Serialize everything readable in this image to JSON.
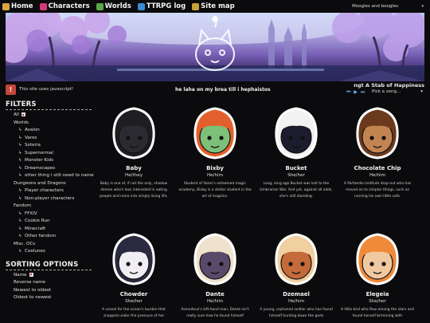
{
  "nav": {
    "items": [
      {
        "label": "Home",
        "icon": "home-icon",
        "color": "#d9a441"
      },
      {
        "label": "Characters",
        "icon": "characters-icon",
        "color": "#d23a7a"
      },
      {
        "label": "Worlds",
        "icon": "worlds-icon",
        "color": "#5aa84a"
      },
      {
        "label": "TTRPG log",
        "icon": "dice-icon",
        "color": "#3a8bd2"
      },
      {
        "label": "Site map",
        "icon": "map-icon",
        "color": "#c9a23a"
      }
    ],
    "theme_select": "Moogles and boogles"
  },
  "info": {
    "js_warning": "This site uses javascript!",
    "marquee": "he laha on my brea till i hephaistos"
  },
  "player": {
    "song_title": "ngt A Stab of Happiness",
    "pick_label": "Pick a song..."
  },
  "sidebar": {
    "filters_title": "FILTERS",
    "filters": [
      {
        "label": "All",
        "level": 0,
        "checkbox": true
      },
      {
        "label": "Worlds",
        "level": 0
      },
      {
        "label": "Avalon",
        "level": 1
      },
      {
        "label": "Varos",
        "level": 1
      },
      {
        "label": "Soteria",
        "level": 1
      },
      {
        "label": "Supernormal",
        "level": 1
      },
      {
        "label": "Monster Kids",
        "level": 1
      },
      {
        "label": "Dreamscapes",
        "level": 1
      },
      {
        "label": "other thing i still need to name",
        "level": 1
      },
      {
        "label": "Dungeons and Dragons",
        "level": 0
      },
      {
        "label": "Player characters",
        "level": 1
      },
      {
        "label": "Non-player characters",
        "level": 1
      },
      {
        "label": "Fandom",
        "level": 0
      },
      {
        "label": "FFXIV",
        "level": 1
      },
      {
        "label": "Cookie Run",
        "level": 1
      },
      {
        "label": "Minecraft",
        "level": 1
      },
      {
        "label": "Other fandom",
        "level": 1
      },
      {
        "label": "Misc. OCs",
        "level": 0
      },
      {
        "label": "Coelunes",
        "level": 1
      }
    ],
    "sorting_title": "SORTING OPTIONS",
    "sorting": [
      {
        "label": "Name",
        "checkbox": true
      },
      {
        "label": "Reverse name"
      },
      {
        "label": "Newest to oldest"
      },
      {
        "label": "Oldest to newest"
      }
    ]
  },
  "characters": [
    {
      "name": "Baby",
      "pronouns": "He/they",
      "desc": "Baby is one of, if not the only, shadow demon who's less interested in eating people and more into simply living life.",
      "hair": "#1e1e22",
      "skin": "#2a2a30"
    },
    {
      "name": "Bixby",
      "pronouns": "He/him",
      "desc": "Student of Varos's esteemed magic academy, Bixby is a stellar student in the art of magicks.",
      "hair": "#e3602c",
      "skin": "#7dc07a"
    },
    {
      "name": "Bucket",
      "pronouns": "She/her",
      "desc": "Long, long ago Bucket was lost to the Umbrarian War. And yet, against all odds, she's still standing.",
      "hair": "#f2f2f2",
      "skin": "#1c1c2c"
    },
    {
      "name": "Chocolate Chip",
      "pronouns": "He/him",
      "desc": "A Parfaedia institute drop-out who has moved on to simpler things, such as running his own little cafe.",
      "hair": "#6b3a1e",
      "skin": "#c28552"
    },
    {
      "name": "Chowder",
      "pronouns": "She/her",
      "desc": "A vessel for the ocean's burden that snapped under the pressure of her",
      "hair": "#2a2a40",
      "skin": "#f0eef2"
    },
    {
      "name": "Dante",
      "pronouns": "He/him",
      "desc": "Asmodeus's left-hand man, Dante isn't really sure how he found himself",
      "hair": "#efe2cc",
      "skin": "#5a4a6a"
    },
    {
      "name": "Dzemael",
      "pronouns": "He/him",
      "desc": "A young, orphaned soldier who has found himself hunting down the gods",
      "hair": "#f0cfa0",
      "skin": "#c56a3a"
    },
    {
      "name": "Elegeia",
      "pronouns": "She/her",
      "desc": "A little bird who flew among the stars and found herself brimming with",
      "hair": "#f08a3a",
      "skin": "#f1c9a0"
    }
  ]
}
